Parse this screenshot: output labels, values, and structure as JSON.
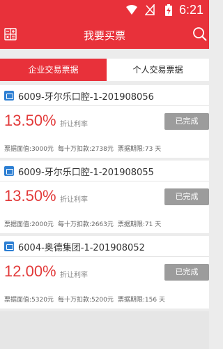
{
  "status_bar": {
    "time": "6:21"
  },
  "header": {
    "title": "我要买票",
    "menu_icon": "calculator-icon",
    "search_icon": "search-icon"
  },
  "tabs": [
    {
      "label": "企业交易票据",
      "active": true
    },
    {
      "label": "个人交易票据",
      "active": false
    }
  ],
  "tickets": [
    {
      "name": "6009-牙尔乐口腔-1-201908056",
      "rate": "13.50%",
      "rate_label": "折让利率",
      "status": "已完成",
      "face_value": "票据面值:3000元",
      "discount": "每十万扣款:2738元",
      "term": "票据期限:73 天"
    },
    {
      "name": "6009-牙尔乐口腔-1-201908055",
      "rate": "13.50%",
      "rate_label": "折让利率",
      "status": "已完成",
      "face_value": "票据面值:2000元",
      "discount": "每十万扣款:2663元",
      "term": "票据期限:71 天"
    },
    {
      "name": "6004-奥德集团-1-201908052",
      "rate": "12.00%",
      "rate_label": "折让利率",
      "status": "已完成",
      "face_value": "票据面值:5320元",
      "discount": "每十万扣款:5200元",
      "term": "票据期限:156 天"
    }
  ],
  "colors": {
    "primary": "#e8313a",
    "rate": "#e23a3a",
    "status_button": "#9c9c9c"
  }
}
